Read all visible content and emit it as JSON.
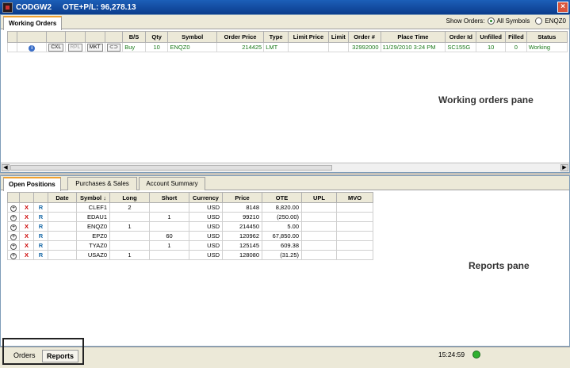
{
  "window": {
    "title": "CODGW2",
    "ote_label": "OTE+P/L: 96,278.13",
    "close_label": "×"
  },
  "orders_pane": {
    "tab": "Working Orders",
    "show_orders_label": "Show Orders:",
    "radio_all": "All Symbols",
    "radio_symbol": "ENQZ0",
    "columns": [
      "",
      "",
      "",
      "",
      "",
      "",
      "B/S",
      "Qty",
      "Symbol",
      "Order Price",
      "Type",
      "Limit Price",
      "Limit",
      "Order #",
      "Place Time",
      "Order Id",
      "Unfilled",
      "Filled",
      "Status"
    ],
    "row": {
      "cxl": "CXL",
      "rpl": "RPL",
      "mkt": "MKT",
      "bs": "Buy",
      "qty": "10",
      "symbol": "ENQZ0",
      "order_price": "214425",
      "type": "LMT",
      "limit_price": "",
      "limit": "",
      "order_no": "32992000",
      "place_time": "11/29/2010 3:24 PM",
      "order_id": "SC155G",
      "unfilled": "10",
      "filled": "0",
      "status": "Working"
    },
    "label": "Working orders pane"
  },
  "reports_pane": {
    "tabs": [
      "Open Positions",
      "Purchases & Sales",
      "Account Summary"
    ],
    "columns": [
      "",
      "",
      "",
      "Date",
      "Symbol ↓",
      "Long",
      "Short",
      "Currency",
      "Price",
      "OTE",
      "UPL",
      "MVO"
    ],
    "rows": [
      {
        "symbol": "CLEF1",
        "long": "2",
        "short": "",
        "currency": "USD",
        "price": "8148",
        "ote": "8,820.00"
      },
      {
        "symbol": "EDAU1",
        "long": "",
        "short": "1",
        "currency": "USD",
        "price": "99210",
        "ote": "(250.00)"
      },
      {
        "symbol": "ENQZ0",
        "long": "1",
        "short": "",
        "currency": "USD",
        "price": "214450",
        "ote": "5.00"
      },
      {
        "symbol": "EPZ0",
        "long": "",
        "short": "60",
        "currency": "USD",
        "price": "120962",
        "ote": "67,850.00"
      },
      {
        "symbol": "TYAZ0",
        "long": "",
        "short": "1",
        "currency": "USD",
        "price": "125145",
        "ote": "609.38"
      },
      {
        "symbol": "USAZ0",
        "long": "1",
        "short": "",
        "currency": "USD",
        "price": "128080",
        "ote": "(31.25)"
      }
    ],
    "x_label": "X",
    "r_label": "R",
    "label": "Reports pane"
  },
  "statusbar": {
    "tab_orders": "Orders",
    "tab_reports": "Reports",
    "time": "15:24:59"
  }
}
